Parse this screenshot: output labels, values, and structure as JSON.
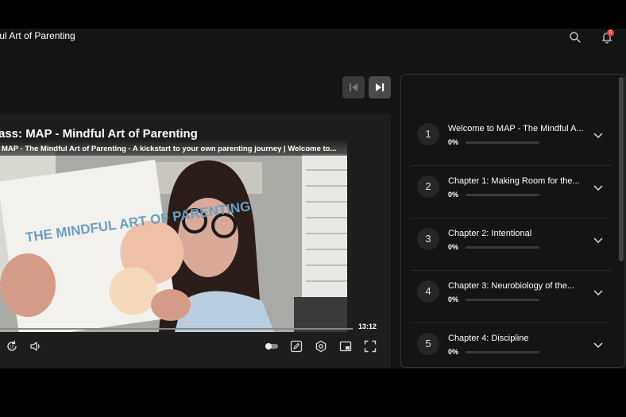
{
  "app": {
    "title": "ful Art of Parenting",
    "notification_count": "0"
  },
  "player": {
    "class_title": "ass: MAP - Mindful Art of Parenting",
    "video_subtitle": "MAP - The Mindful Art of Parenting - A kickstart to your own parenting journey | Welcome to...",
    "duration": "13:12",
    "book_title": "THE MINDFUL ART OF PARENTING"
  },
  "chapters": [
    {
      "num": "1",
      "title": "Welcome to MAP - The Mindful A...",
      "progress": "0%"
    },
    {
      "num": "2",
      "title": "Chapter 1: Making Room for the...",
      "progress": "0%"
    },
    {
      "num": "3",
      "title": "Chapter 2: Intentional",
      "progress": "0%"
    },
    {
      "num": "4",
      "title": "Chapter 3: Neurobiology of the...",
      "progress": "0%"
    },
    {
      "num": "5",
      "title": "Chapter 4: Discipline",
      "progress": "0%"
    }
  ]
}
